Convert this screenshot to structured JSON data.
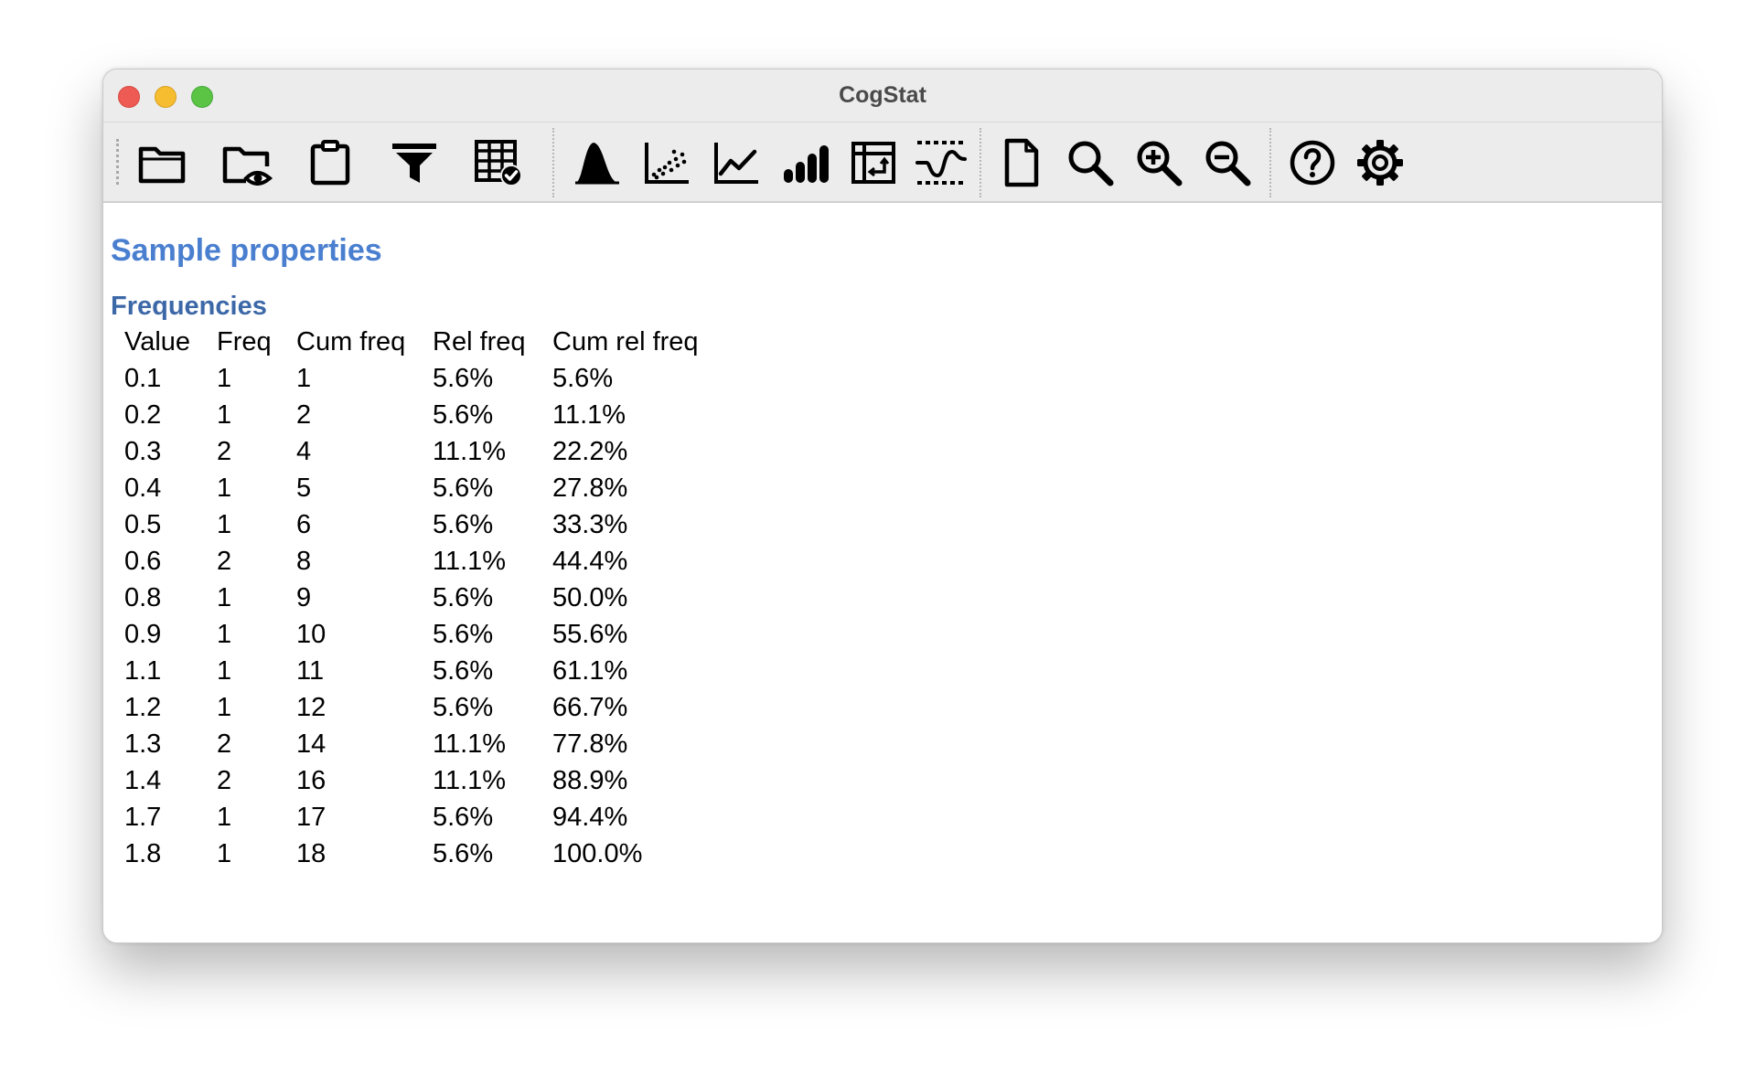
{
  "window": {
    "title": "CogStat"
  },
  "toolbar": {
    "buttons": [
      {
        "name": "open-data-file",
        "icon": "folder-icon"
      },
      {
        "name": "open-demo-file",
        "icon": "folder-eye-icon"
      },
      {
        "name": "paste-data",
        "icon": "clipboard-icon"
      },
      {
        "name": "filter-outliers",
        "icon": "filter-icon"
      },
      {
        "name": "display-data",
        "icon": "grid-check-icon"
      },
      {
        "name": "explore-variable",
        "icon": "distribution-icon"
      },
      {
        "name": "explore-relation",
        "icon": "scatterplot-icon"
      },
      {
        "name": "reliability-analysis",
        "icon": "line-chart-icon"
      },
      {
        "name": "compare-groups",
        "icon": "bar-chart-icon"
      },
      {
        "name": "pivot-table",
        "icon": "pivot-table-icon"
      },
      {
        "name": "behavioral-data-diffusion",
        "icon": "diffusion-icon"
      },
      {
        "name": "clear-results",
        "icon": "blank-page-icon"
      },
      {
        "name": "find-text",
        "icon": "search-icon"
      },
      {
        "name": "zoom-in",
        "icon": "zoom-in-icon"
      },
      {
        "name": "zoom-out",
        "icon": "zoom-out-icon"
      },
      {
        "name": "help",
        "icon": "help-icon"
      },
      {
        "name": "preferences",
        "icon": "gear-icon"
      }
    ]
  },
  "results": {
    "heading": "Sample properties",
    "subheading": "Frequencies",
    "columns": [
      "Value",
      "Freq",
      "Cum freq",
      "Rel freq",
      "Cum rel freq"
    ],
    "rows": [
      [
        "0.1",
        "1",
        "1",
        "5.6%",
        "5.6%"
      ],
      [
        "0.2",
        "1",
        "2",
        "5.6%",
        "11.1%"
      ],
      [
        "0.3",
        "2",
        "4",
        "11.1%",
        "22.2%"
      ],
      [
        "0.4",
        "1",
        "5",
        "5.6%",
        "27.8%"
      ],
      [
        "0.5",
        "1",
        "6",
        "5.6%",
        "33.3%"
      ],
      [
        "0.6",
        "2",
        "8",
        "11.1%",
        "44.4%"
      ],
      [
        "0.8",
        "1",
        "9",
        "5.6%",
        "50.0%"
      ],
      [
        "0.9",
        "1",
        "10",
        "5.6%",
        "55.6%"
      ],
      [
        "1.1",
        "1",
        "11",
        "5.6%",
        "61.1%"
      ],
      [
        "1.2",
        "1",
        "12",
        "5.6%",
        "66.7%"
      ],
      [
        "1.3",
        "2",
        "14",
        "11.1%",
        "77.8%"
      ],
      [
        "1.4",
        "2",
        "16",
        "11.1%",
        "88.9%"
      ],
      [
        "1.7",
        "1",
        "17",
        "5.6%",
        "94.4%"
      ],
      [
        "1.8",
        "1",
        "18",
        "5.6%",
        "100.0%"
      ]
    ]
  },
  "colors": {
    "heading": "#4a7fd0",
    "subheading": "#3d68a8",
    "close": "#ee5b55",
    "minimize": "#f5bd2f",
    "maximize": "#5bc445"
  }
}
